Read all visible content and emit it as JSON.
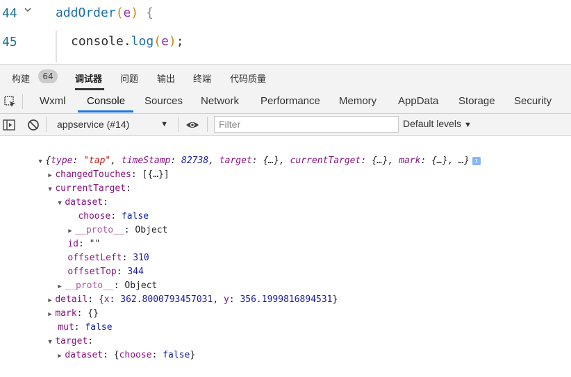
{
  "editor": {
    "lines": [
      {
        "number": "44",
        "fn": "addOrder",
        "open_paren": "(",
        "param": "e",
        "close_paren": ")",
        "brace": " {"
      },
      {
        "number": "45",
        "obj": "console.",
        "call": "log",
        "open_paren": "(",
        "param": "e",
        "close_paren": ")",
        "semicolon": ";"
      }
    ]
  },
  "top_tabs": {
    "build": "构建",
    "build_badge": "64",
    "debugger": "调试器",
    "issues": "问题",
    "output": "输出",
    "terminal": "终端",
    "code_quality": "代码质量"
  },
  "panel_tabs": [
    "Wxml",
    "Console",
    "Sources",
    "Network",
    "Performance",
    "Memory",
    "AppData",
    "Storage",
    "Security"
  ],
  "console_bar": {
    "context": "appservice (#14)",
    "filter_placeholder": "Filter",
    "levels": "Default levels"
  },
  "console": {
    "summary": {
      "type_key": "type",
      "type_val": "\"tap\"",
      "ts_key": "timeStamp",
      "ts_val": "82738",
      "target_key": "target",
      "ellipsis_obj": "{…}",
      "ct_key": "currentTarget",
      "mark_key": "mark",
      "tail": "…"
    },
    "changedTouches": {
      "key": "changedTouches",
      "val": "[{…}]"
    },
    "currentTarget": {
      "key": "currentTarget"
    },
    "dataset": {
      "key": "dataset"
    },
    "choose": {
      "key": "choose",
      "val": "false"
    },
    "proto": {
      "key": "__proto__",
      "val": "Object"
    },
    "id": {
      "key": "id",
      "val": "\"\""
    },
    "offsetLeft": {
      "key": "offsetLeft",
      "val": "310"
    },
    "offsetTop": {
      "key": "offsetTop",
      "val": "344"
    },
    "detail": {
      "key": "detail",
      "x_key": "x",
      "x_val": "362.8000793457031",
      "y_key": "y",
      "y_val": "356.1999816894531"
    },
    "mark": {
      "key": "mark",
      "val": "{}"
    },
    "mut": {
      "key": "mut",
      "val": "false"
    },
    "target": {
      "key": "target"
    },
    "target_dataset": {
      "key": "dataset",
      "choose_key": "choose",
      "choose_val": "false"
    }
  },
  "icons": {
    "fold": "chevron-down-icon",
    "inspect": "inspect-element-icon",
    "sidebar": "sidebar-toggle-icon",
    "clear": "clear-console-icon",
    "eye": "eye-icon",
    "info": "info-icon"
  },
  "colors": {
    "accent": "#1a73e8",
    "keyword": "#881280",
    "string": "#c41a16",
    "number": "#1a1aa6"
  }
}
